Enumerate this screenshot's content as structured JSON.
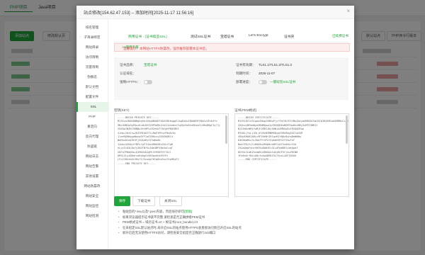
{
  "bg": {
    "tabs": [
      "PHP项目",
      "Java项目"
    ],
    "buttons": [
      "添加站点",
      "修改默认页",
      "默认站点",
      "PHP命令行版本"
    ]
  },
  "modal": {
    "title": "站点修改[154.62.47.153] -- 添加时间[2025-11-17 11:56:16]",
    "close": "×",
    "sidebar": [
      "域名管理",
      "子目录绑定",
      "网站目录",
      "访问限制",
      "流量限制",
      "伪静态",
      "默认文档",
      "配置文件",
      "SSL",
      "PHP",
      "重定向",
      "反向代理",
      "防盗链",
      "网站日志",
      "网站告警",
      "其他设置",
      "网站防篡改",
      "网站安全",
      "网站监控",
      "网站检测"
    ],
    "tabs": [
      "商用证书 - (证书续签SSL)",
      "测试SSL证书",
      "宝塔证书",
      "Let's Encrypt",
      "证书夹"
    ],
    "tab_link": "已续费证书",
    "notice": "温馨提示：本网站HTTPS防篡改，强烈推荐部署本证书后，",
    "notice_link": ">>使用手册",
    "info": {
      "brand_label": "证书品牌：",
      "brand": "宝塔证书",
      "domain_label": "认证域名：",
      "domain": "",
      "https_label": "强制HTTPS：",
      "version_label": "证书有效期：",
      "version": "TLS1.1/TLS1.2/TLS1.3",
      "expire_label": "到期时间：",
      "expire": "2026-11-07",
      "deploy_label": "部署进度：",
      "deploy": "一键续签SSL证书"
    },
    "key_label": "密钥(KEY)",
    "cert_label": "证书(PEM格式)",
    "key_text": "-----BEGIN PRIVATE KEY-----\nMIIEvwIBADANBgkqhkiG9w0BAQEFAASCBKkwggSlAgEAAoIBAQDMfYBkGvVEcb4fx\n9N+HUNZqZgPQuzK+WiRXIVHP5AMnVzkCCA4uHzuTqGUy9e0teEHxbCLtMo0MgCIy7Jj\nSGE8pYW3HC58NNc0Ye0PsiR2ekhFYbIghPBOfB6I\n4+Hp+ZdtGrwJKZ7MIb0ITl+MpEYMfnzFNuKcEx\n1leeRO9WygoNayq5YFIaS3RHzuy3EQSHQBl4\nWoRkxD2xQSK3Fj5QXaRyYZ3q8o0b\nJJm4v4ZhNyfYBPs7gFTLNzGM0QGBzVGvtTgB\nhLyvItOXLBo7yZ6OTBfVuINe3BFE8e3oCxqT\nX0Fq7P8dQ0s+Q1MA9n8JgMl3YH58FVYT42l\nUR9jZLyzDBdrvaEb6gVzVB5qnUUsE5Y9l\nL5rjG0GzU6iV8s7IJ3cuAg7KIqDkd2sx7hpHKyEY\n-----END PRIVATE KEY-----",
    "cert_text": "-----BEGIN CERTIFICATE-----\nMIIEiDCCA3CgAwIBAgISBKwPjyfTmY4k7E1tMoZpeyaoMA0GCSqGSIb3DQEBCwUAMDMxCzAJBgNVBAYTAlVTMRYwFAYDVQQKEw1M\nZXQncyBFbmNyeXB0MQwwCgYDVQQDEwNSMTAwHhcNMjUxMTE3MDI1\nNjE1WhcNMjYwMjE1MDI1NjE0WjAXMRUwEwYDVQQDEww\nMTU0LjYyLjQ3LjE1MzBZMBMGByqGSM49AgEGCCqGSM\n49AwEHA0IABLc9P2HkNfJR1qnH1YNOz8yhoDeWHNq\nK4KAbmMxc3+Zbm7PrGFkYVpkbE9EG2TSVwTaT\nMwk7PEyYjYc8Hd9w2M4bNrdHFCx6Y5sUHkrIGd\nZ4GaQmpFqhcVHCKo8bDtEu3I+UPpW8DlLWsQpbf\n8GfDz1LmHZhvaW5n4RKoUsIdXyDhF5fjnwVRCNB\n1Fm9oGrfN1zQ8cfwkoUDHKX3sTYpsL45FI0VhH\n-----END CERTIFICATE-----",
    "buttons": {
      "save": "保存",
      "download": "下载证书",
      "close_ssl": "关闭SSL"
    },
    "tips": [
      {
        "text": "粘贴您的*.key以及*.pem内容，然后保存即可",
        "link": "[帮助]"
      },
      {
        "text": "如果浏览器提示证书链不完整,请检查是否正确拼接PEM证书",
        "link": ""
      },
      {
        "text": "PEM格式证书 = 域名证书.crt + 根证书(root_bundle).crt",
        "link": ""
      },
      {
        "text": "在未指定SSL默认站点时,未开启SSL的站点使用HTTPS会直接访问到已开启SSL的站点",
        "link": ""
      },
      {
        "text": "如开启后无法使用HTTPS访问，请检查安全组是否正确放行443端口",
        "link": ""
      }
    ]
  },
  "colors": {
    "accent": "#20a53a",
    "danger": "#e05050"
  }
}
